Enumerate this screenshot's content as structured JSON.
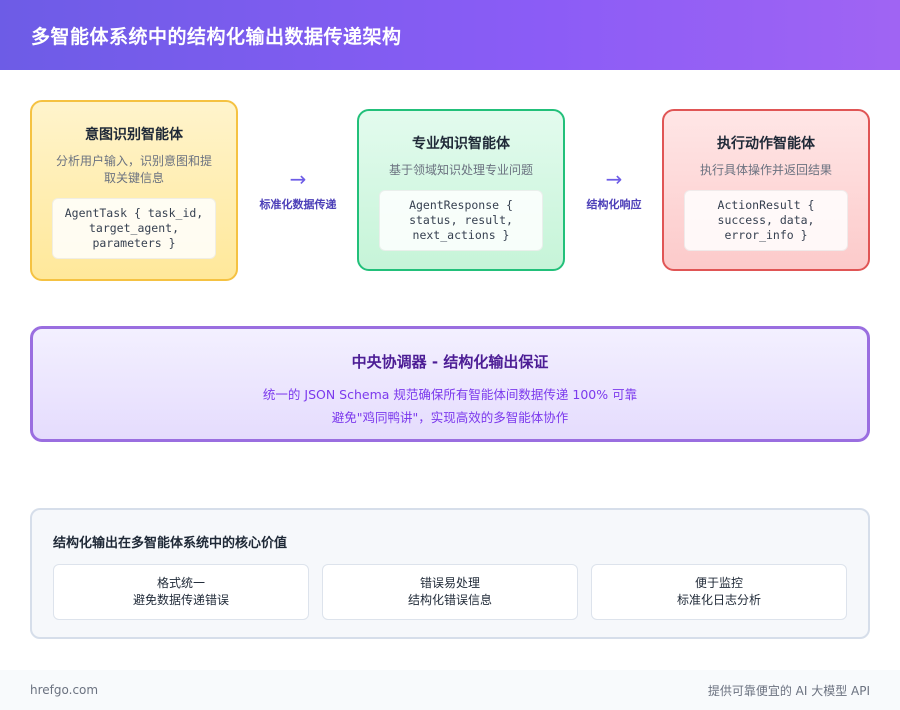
{
  "header": {
    "title": "多智能体系统中的结构化输出数据传递架构"
  },
  "agents": [
    {
      "title": "意图识别智能体",
      "desc": [
        "分析用户输入，识别意图和提",
        "取关键信息"
      ],
      "code": [
        "AgentTask { task_id,",
        "target_agent,",
        "parameters }"
      ]
    },
    {
      "title": "专业知识智能体",
      "desc": [
        "基于领域知识处理专业问题"
      ],
      "code": [
        "AgentResponse {",
        "status, result,",
        "next_actions }"
      ]
    },
    {
      "title": "执行动作智能体",
      "desc": [
        "执行具体操作并返回结果"
      ],
      "code": [
        "ActionResult {",
        "success, data,",
        "error_info }"
      ]
    }
  ],
  "connectors": [
    {
      "arrow": "→",
      "label": "标准化数据传递"
    },
    {
      "arrow": "→",
      "label": "结构化响应"
    }
  ],
  "coordinator": {
    "title": "中央协调器 - 结构化输出保证",
    "lines": [
      "统一的 JSON Schema 规范确保所有智能体间数据传递 100% 可靠",
      "避免\"鸡同鸭讲\"，实现高效的多智能体协作"
    ]
  },
  "values": {
    "title": "结构化输出在多智能体系统中的核心价值",
    "cards": [
      {
        "line1": "格式统一",
        "line2": "避免数据传递错误"
      },
      {
        "line1": "错误易处理",
        "line2": "结构化错误信息"
      },
      {
        "line1": "便于监控",
        "line2": "标准化日志分析"
      }
    ]
  },
  "footer": {
    "left": "hrefgo.com",
    "right": "提供可靠便宜的 AI 大模型 API"
  },
  "colors": {
    "accent": "#6d5ce6",
    "intent_border": "#f5c242",
    "expert_border": "#22c07a",
    "exec_border": "#e05555",
    "coordinator_border": "#9a6ee0"
  }
}
